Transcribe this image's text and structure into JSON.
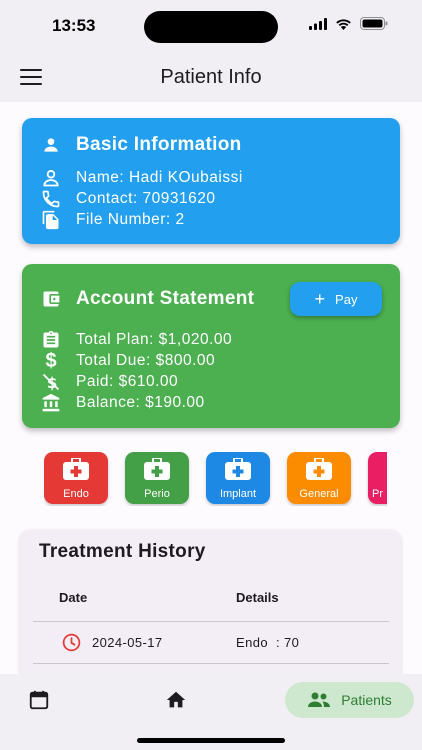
{
  "status_bar": {
    "time": "13:53"
  },
  "app_bar": {
    "title": "Patient Info",
    "menu_icon": "hamburger-menu-icon"
  },
  "basic_info": {
    "title": "Basic Information",
    "name": "Name: Hadi KOubaissi",
    "contact": "Contact: 70931620",
    "file_number": "File Number: 2",
    "color": "#239ff0"
  },
  "account": {
    "title": "Account Statement",
    "pay_label": "Pay",
    "total_plan": "Total Plan: $1,020.00",
    "total_due": "Total Due: $800.00",
    "paid": "Paid: $610.00",
    "balance": "Balance: $190.00",
    "color": "#4caf50"
  },
  "categories": [
    {
      "label": "Endo",
      "color": "#e53935"
    },
    {
      "label": "Perio",
      "color": "#43a047"
    },
    {
      "label": "Implant",
      "color": "#1e88e5"
    },
    {
      "label": "General",
      "color": "#fb8c00"
    },
    {
      "label": "Pr",
      "color": "#e91e63"
    }
  ],
  "history": {
    "title": "Treatment History",
    "columns": [
      "Date",
      "Details"
    ],
    "rows": [
      {
        "date": "2024-05-17",
        "details": "Endo  : 70"
      }
    ]
  },
  "bottom_nav": {
    "calendar_icon": "calendar-icon",
    "home_icon": "home-icon",
    "patients_label": "Patients",
    "active_color": "#2e7d32"
  }
}
